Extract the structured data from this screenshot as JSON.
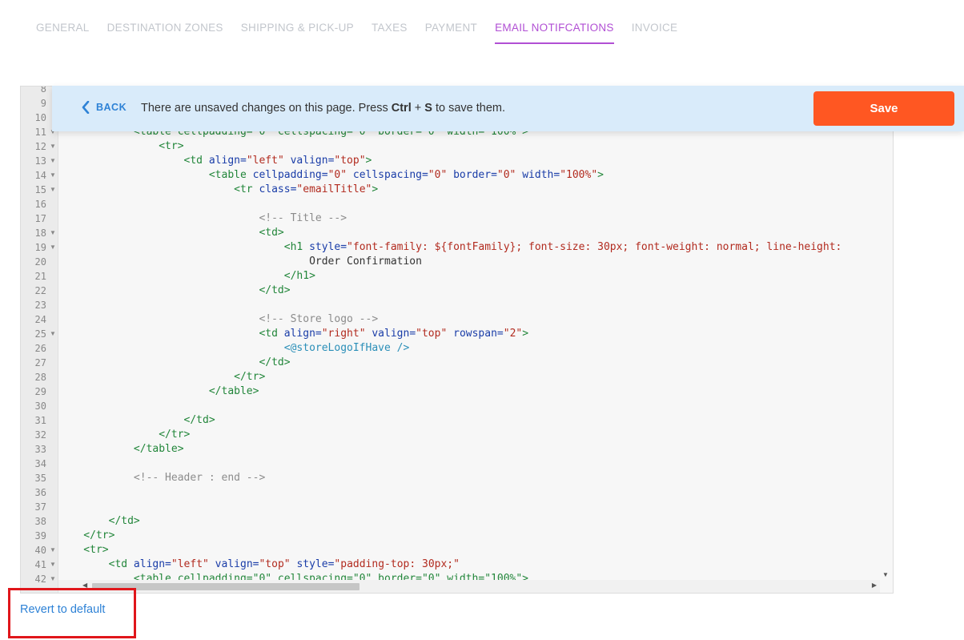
{
  "tabs": [
    {
      "label": "GENERAL",
      "active": false
    },
    {
      "label": "DESTINATION ZONES",
      "active": false
    },
    {
      "label": "SHIPPING & PICK-UP",
      "active": false
    },
    {
      "label": "TAXES",
      "active": false
    },
    {
      "label": "PAYMENT",
      "active": false
    },
    {
      "label": "EMAIL NOTIFCATIONS",
      "active": true
    },
    {
      "label": "INVOICE",
      "active": false
    }
  ],
  "unsaved": {
    "back_label": "BACK",
    "message_before": "There are unsaved changes on this page. Press ",
    "key_ctrl": "Ctrl",
    "key_plus": " + ",
    "key_s": "S",
    "message_after": " to save them.",
    "save_label": "Save"
  },
  "revert_label": "Revert to default",
  "editor": {
    "lines": [
      {
        "n": "8",
        "fold": false,
        "segs": []
      },
      {
        "n": "9",
        "fold": false,
        "segs": []
      },
      {
        "n": "10",
        "fold": false,
        "segs": []
      },
      {
        "n": "11",
        "fold": true,
        "segs": [
          {
            "t": "            <table cellpadding=\"0\" cellspacing=\"0\" border=\"0\" width=\"100%\">",
            "c": "tag"
          }
        ]
      },
      {
        "n": "12",
        "fold": true,
        "segs": [
          {
            "t": "                <tr>",
            "c": "tag"
          }
        ]
      },
      {
        "n": "13",
        "fold": true,
        "segs": [
          {
            "t": "                    <td ",
            "c": "tag"
          },
          {
            "t": "align=",
            "c": "attr"
          },
          {
            "t": "\"left\"",
            "c": "str"
          },
          {
            "t": " valign=",
            "c": "attr"
          },
          {
            "t": "\"top\"",
            "c": "str"
          },
          {
            "t": ">",
            "c": "tag"
          }
        ]
      },
      {
        "n": "14",
        "fold": true,
        "segs": [
          {
            "t": "                        <table ",
            "c": "tag"
          },
          {
            "t": "cellpadding=",
            "c": "attr"
          },
          {
            "t": "\"0\"",
            "c": "str"
          },
          {
            "t": " cellspacing=",
            "c": "attr"
          },
          {
            "t": "\"0\"",
            "c": "str"
          },
          {
            "t": " border=",
            "c": "attr"
          },
          {
            "t": "\"0\"",
            "c": "str"
          },
          {
            "t": " width=",
            "c": "attr"
          },
          {
            "t": "\"100%\"",
            "c": "str"
          },
          {
            "t": ">",
            "c": "tag"
          }
        ]
      },
      {
        "n": "15",
        "fold": true,
        "segs": [
          {
            "t": "                            <tr ",
            "c": "tag"
          },
          {
            "t": "class=",
            "c": "attr"
          },
          {
            "t": "\"emailTitle\"",
            "c": "str"
          },
          {
            "t": ">",
            "c": "tag"
          }
        ]
      },
      {
        "n": "16",
        "fold": false,
        "segs": []
      },
      {
        "n": "17",
        "fold": false,
        "segs": [
          {
            "t": "                                <!-- Title -->",
            "c": "com"
          }
        ]
      },
      {
        "n": "18",
        "fold": true,
        "segs": [
          {
            "t": "                                <td>",
            "c": "tag"
          }
        ]
      },
      {
        "n": "19",
        "fold": true,
        "segs": [
          {
            "t": "                                    <h1 ",
            "c": "tag"
          },
          {
            "t": "style=",
            "c": "attr"
          },
          {
            "t": "\"font-family: ${fontFamily}; font-size: 30px; font-weight: normal; line-height:",
            "c": "str"
          }
        ]
      },
      {
        "n": "20",
        "fold": false,
        "segs": [
          {
            "t": "                                        Order Confirmation",
            "c": "txt"
          }
        ]
      },
      {
        "n": "21",
        "fold": false,
        "segs": [
          {
            "t": "                                    </h1>",
            "c": "tag"
          }
        ]
      },
      {
        "n": "22",
        "fold": false,
        "segs": [
          {
            "t": "                                </td>",
            "c": "tag"
          }
        ]
      },
      {
        "n": "23",
        "fold": false,
        "segs": []
      },
      {
        "n": "24",
        "fold": false,
        "segs": [
          {
            "t": "                                <!-- Store logo -->",
            "c": "com"
          }
        ]
      },
      {
        "n": "25",
        "fold": true,
        "segs": [
          {
            "t": "                                <td ",
            "c": "tag"
          },
          {
            "t": "align=",
            "c": "attr"
          },
          {
            "t": "\"right\"",
            "c": "str"
          },
          {
            "t": " valign=",
            "c": "attr"
          },
          {
            "t": "\"top\"",
            "c": "str"
          },
          {
            "t": " rowspan=",
            "c": "attr"
          },
          {
            "t": "\"2\"",
            "c": "str"
          },
          {
            "t": ">",
            "c": "tag"
          }
        ]
      },
      {
        "n": "26",
        "fold": false,
        "segs": [
          {
            "t": "                                    <@storeLogoIfHave />",
            "c": "spc"
          }
        ]
      },
      {
        "n": "27",
        "fold": false,
        "segs": [
          {
            "t": "                                </td>",
            "c": "tag"
          }
        ]
      },
      {
        "n": "28",
        "fold": false,
        "segs": [
          {
            "t": "                            </tr>",
            "c": "tag"
          }
        ]
      },
      {
        "n": "29",
        "fold": false,
        "segs": [
          {
            "t": "                        </table>",
            "c": "tag"
          }
        ]
      },
      {
        "n": "30",
        "fold": false,
        "segs": []
      },
      {
        "n": "31",
        "fold": false,
        "segs": [
          {
            "t": "                    </td>",
            "c": "tag"
          }
        ]
      },
      {
        "n": "32",
        "fold": false,
        "segs": [
          {
            "t": "                </tr>",
            "c": "tag"
          }
        ]
      },
      {
        "n": "33",
        "fold": false,
        "segs": [
          {
            "t": "            </table>",
            "c": "tag"
          }
        ]
      },
      {
        "n": "34",
        "fold": false,
        "segs": []
      },
      {
        "n": "35",
        "fold": false,
        "segs": [
          {
            "t": "            <!-- Header : end -->",
            "c": "com"
          }
        ]
      },
      {
        "n": "36",
        "fold": false,
        "segs": []
      },
      {
        "n": "37",
        "fold": false,
        "segs": []
      },
      {
        "n": "38",
        "fold": false,
        "segs": [
          {
            "t": "        </td>",
            "c": "tag"
          }
        ]
      },
      {
        "n": "39",
        "fold": false,
        "segs": [
          {
            "t": "    </tr>",
            "c": "tag"
          }
        ]
      },
      {
        "n": "40",
        "fold": true,
        "segs": [
          {
            "t": "    <tr>",
            "c": "tag"
          }
        ]
      },
      {
        "n": "41",
        "fold": true,
        "segs": [
          {
            "t": "        <td ",
            "c": "tag"
          },
          {
            "t": "align=",
            "c": "attr"
          },
          {
            "t": "\"left\"",
            "c": "str"
          },
          {
            "t": " valign=",
            "c": "attr"
          },
          {
            "t": "\"top\"",
            "c": "str"
          },
          {
            "t": " style=",
            "c": "attr"
          },
          {
            "t": "\"padding-top: 30px;\"",
            "c": "str"
          }
        ]
      },
      {
        "n": "42",
        "fold": true,
        "segs": [
          {
            "t": "            <table cellpadding=\"0\" cellspacing=\"0\" border=\"0\" width=\"100%\">",
            "c": "tag"
          }
        ]
      }
    ]
  },
  "colors": {
    "accent": "#b14fd4",
    "save": "#ff5722",
    "link": "#2e82d6",
    "bar": "#d9ebfa",
    "highlight_border": "#e0161b"
  }
}
